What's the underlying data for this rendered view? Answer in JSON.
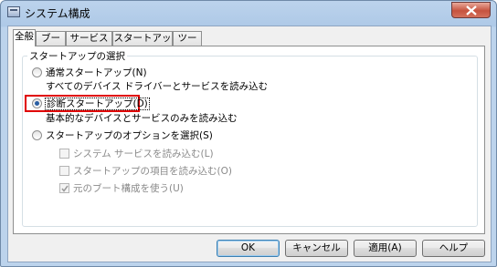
{
  "window": {
    "title": "システム構成"
  },
  "tabs": [
    {
      "label": "全般",
      "active": true
    },
    {
      "label": "ブート",
      "active": false
    },
    {
      "label": "サービス",
      "active": false
    },
    {
      "label": "スタートアップ",
      "active": false
    },
    {
      "label": "ツール",
      "active": false
    }
  ],
  "startup_group": {
    "legend": "スタートアップの選択",
    "normal": {
      "label": "通常スタートアップ(N)",
      "desc": "すべてのデバイス ドライバーとサービスを読み込む",
      "selected": false
    },
    "diagnostic": {
      "label": "診断スタートアップ(D)",
      "desc": "基本的なデバイスとサービスのみを読み込む",
      "selected": true
    },
    "selective": {
      "label": "スタートアップのオプションを選択(S)",
      "selected": false
    },
    "options": [
      {
        "label": "システム サービスを読み込む(L)",
        "checked": false,
        "enabled": false
      },
      {
        "label": "スタートアップの項目を読み込む(O)",
        "checked": false,
        "enabled": false
      },
      {
        "label": "元のブート構成を使う(U)",
        "checked": true,
        "enabled": false
      }
    ]
  },
  "buttons": {
    "ok": "OK",
    "cancel": "キャンセル",
    "apply": "適用(A)",
    "help": "ヘルプ"
  }
}
